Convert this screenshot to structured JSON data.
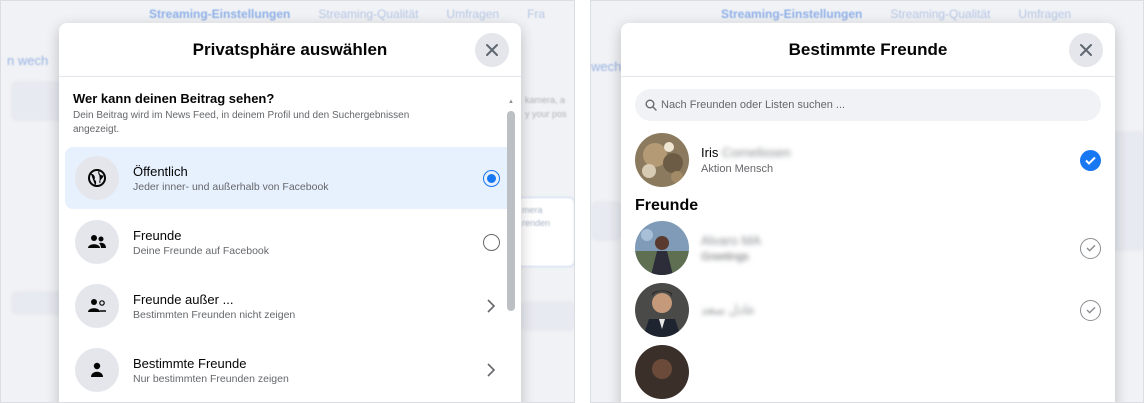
{
  "background": {
    "tabs": [
      "Streaming-Einstellungen",
      "Streaming-Qualität",
      "Umfragen",
      "Fra"
    ],
    "left_side": "n wech",
    "right_side": "wechs",
    "left_card": [
      "mera",
      "renden"
    ],
    "left_snippet": [
      "kamera, a",
      "y your pos"
    ]
  },
  "privacy_modal": {
    "title": "Privatsphäre auswählen",
    "heading": "Wer kann deinen Beitrag sehen?",
    "description": "Dein Beitrag wird im News Feed, in deinem Profil und den Suchergebnissen angezeigt.",
    "options": [
      {
        "title": "Öffentlich",
        "subtitle": "Jeder inner- und außerhalb von Facebook",
        "control": "radio-selected",
        "icon": "globe-icon"
      },
      {
        "title": "Freunde",
        "subtitle": "Deine Freunde auf Facebook",
        "control": "radio",
        "icon": "friends-icon"
      },
      {
        "title": "Freunde außer ...",
        "subtitle": "Bestimmten Freunden nicht zeigen",
        "control": "chevron",
        "icon": "friends-except-icon"
      },
      {
        "title": "Bestimmte Freunde",
        "subtitle": "Nur bestimmten Freunden zeigen",
        "control": "chevron",
        "icon": "specific-friend-icon"
      }
    ]
  },
  "friends_modal": {
    "title": "Bestimmte Freunde",
    "search_placeholder": "Nach Freunden oder Listen suchen ...",
    "selected_friend": {
      "first_name": "Iris",
      "last_name": "Cornelissen",
      "subtitle": "Aktion Mensch"
    },
    "section_title": "Freunde",
    "friends": [
      {
        "name": "Alvaro MA",
        "subtitle": "Greetings"
      },
      {
        "name": "عادل سعد",
        "subtitle": ""
      }
    ]
  },
  "colors": {
    "accent": "#1877f2",
    "selected_bg": "#e7f0fd",
    "icon_bg": "#e4e6eb",
    "text_secondary": "#65676b"
  }
}
